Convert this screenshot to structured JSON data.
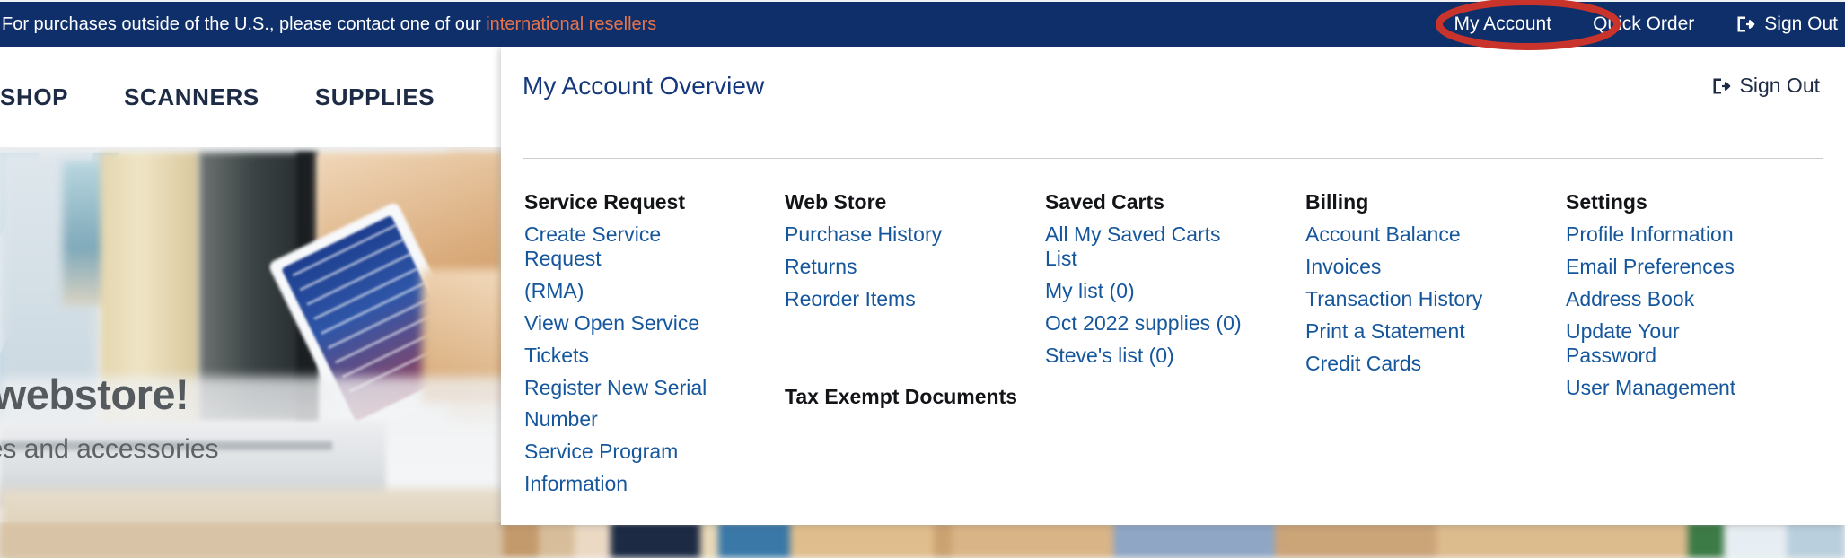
{
  "topbar": {
    "message_prefix": "For purchases outside of the U.S., please contact one of our ",
    "reseller_link": "international resellers",
    "my_account": "My Account",
    "quick_order": "Quick Order",
    "sign_out": "Sign Out",
    "background_color": "#0E2F69",
    "link_color": "#E8734A"
  },
  "nav": {
    "items": [
      {
        "label": "SHOP"
      },
      {
        "label": "SCANNERS"
      },
      {
        "label": "SUPPLIES"
      }
    ]
  },
  "annotation": {
    "shape": "ellipse",
    "color": "#C8342B",
    "target": "My Account"
  },
  "hero": {
    "headline_fragment": "to our webstore!",
    "subline_fragment": "ers, supplies and accessories"
  },
  "dropdown": {
    "title": "My Account Overview",
    "sign_out": "Sign Out",
    "columns": [
      {
        "heading": "Service Request",
        "links": [
          "Create Service Request",
          "(RMA)",
          "View Open Service",
          "Tickets",
          "Register New Serial",
          "Number",
          "Service Program",
          "Information"
        ]
      },
      {
        "heading": "Web Store",
        "links": [
          "Purchase History",
          "Returns",
          "Reorder Items"
        ],
        "second_heading": "Tax Exempt Documents"
      },
      {
        "heading": "Saved Carts",
        "links": [
          "All My Saved Carts List",
          "My list (0)",
          "Oct 2022 supplies (0)",
          "Steve's list (0)"
        ]
      },
      {
        "heading": "Billing",
        "links": [
          "Account Balance",
          "Invoices",
          "Transaction History",
          "Print a Statement",
          "Credit Cards"
        ]
      },
      {
        "heading": "Settings",
        "links": [
          "Profile Information",
          "Email Preferences",
          "Address Book",
          "Update Your Password",
          "User Management"
        ]
      }
    ]
  }
}
